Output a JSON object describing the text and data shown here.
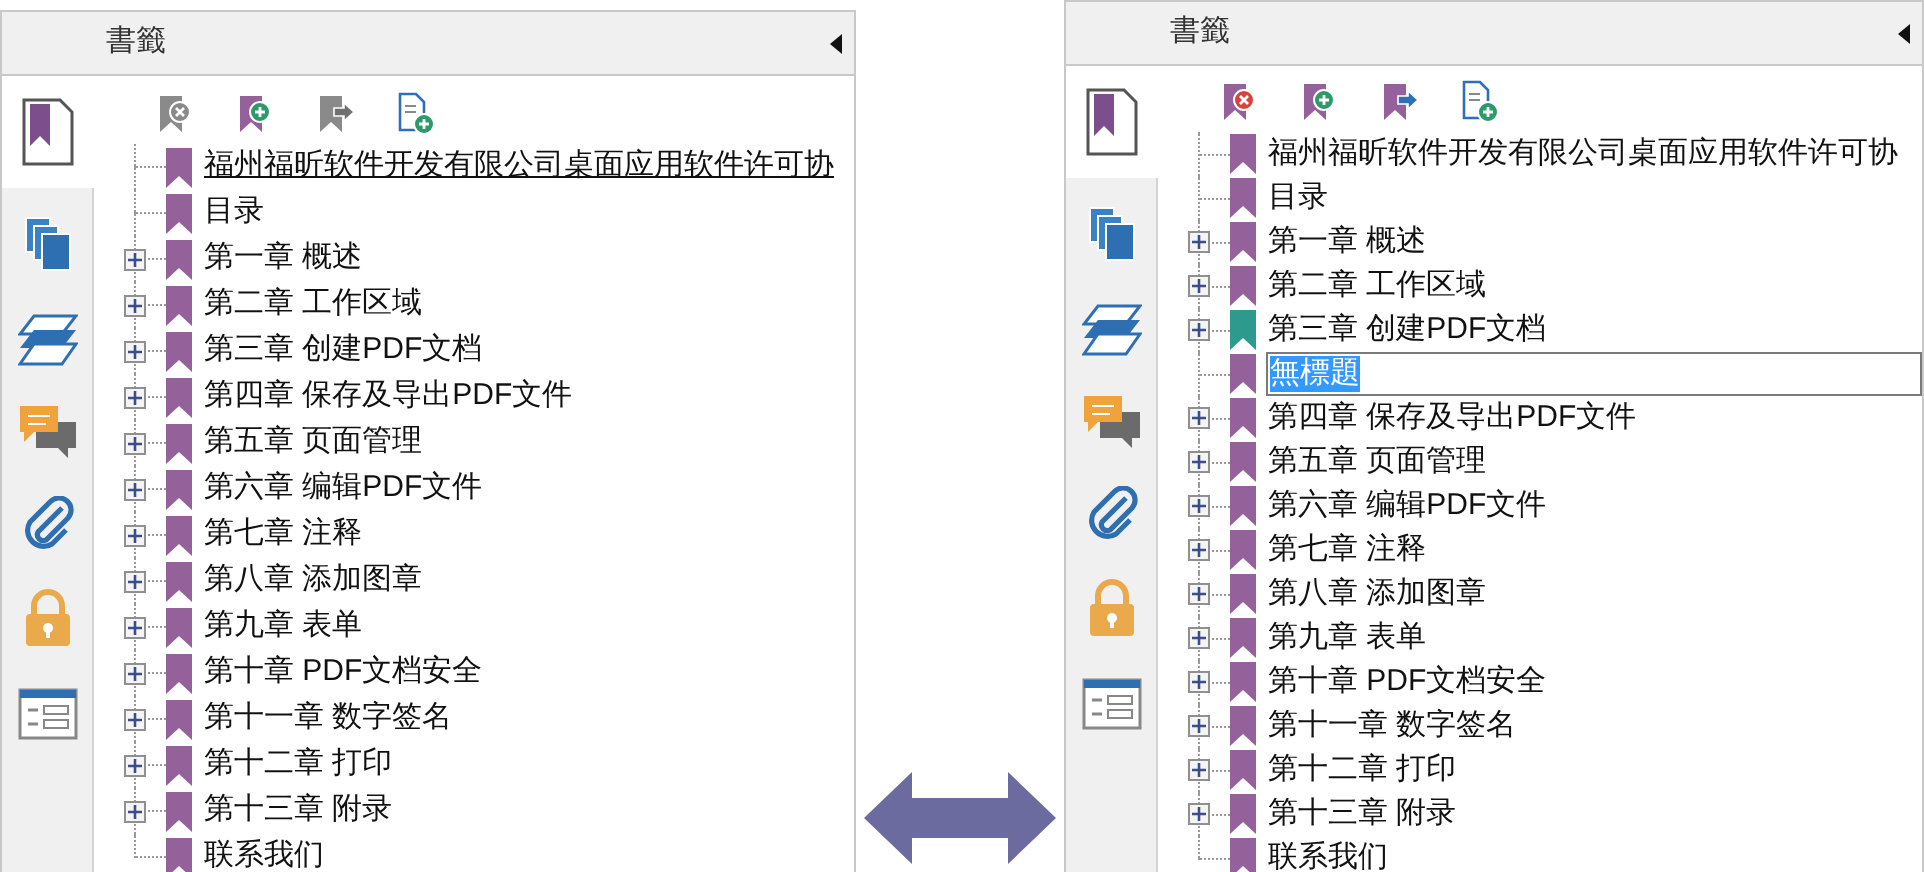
{
  "panels": [
    {
      "title": "書籤",
      "toolbar": [
        {
          "kind": "delete",
          "disabled": true
        },
        {
          "kind": "add",
          "disabled": false
        },
        {
          "kind": "move",
          "disabled": true
        },
        {
          "kind": "new-from-page",
          "disabled": false
        }
      ],
      "items": [
        {
          "text": "福州福昕软件开发有限公司桌面应用软件许可协",
          "expandable": false,
          "underlined": true,
          "editing": false,
          "color": "#94619a"
        },
        {
          "text": "目录",
          "expandable": false,
          "underlined": false,
          "editing": false,
          "color": "#94619a"
        },
        {
          "text": "第一章  概述",
          "expandable": true,
          "underlined": false,
          "editing": false,
          "color": "#94619a"
        },
        {
          "text": "第二章 工作区域",
          "expandable": true,
          "underlined": false,
          "editing": false,
          "color": "#94619a"
        },
        {
          "text": "第三章 创建PDF文档",
          "expandable": true,
          "underlined": false,
          "editing": false,
          "color": "#94619a"
        },
        {
          "text": "第四章 保存及导出PDF文件",
          "expandable": true,
          "underlined": false,
          "editing": false,
          "color": "#94619a"
        },
        {
          "text": "第五章 页面管理",
          "expandable": true,
          "underlined": false,
          "editing": false,
          "color": "#94619a"
        },
        {
          "text": "第六章 编辑PDF文件",
          "expandable": true,
          "underlined": false,
          "editing": false,
          "color": "#94619a"
        },
        {
          "text": "第七章 注释",
          "expandable": true,
          "underlined": false,
          "editing": false,
          "color": "#94619a"
        },
        {
          "text": "第八章 添加图章",
          "expandable": true,
          "underlined": false,
          "editing": false,
          "color": "#94619a"
        },
        {
          "text": "第九章 表单",
          "expandable": true,
          "underlined": false,
          "editing": false,
          "color": "#94619a"
        },
        {
          "text": "第十章 PDF文档安全",
          "expandable": true,
          "underlined": false,
          "editing": false,
          "color": "#94619a"
        },
        {
          "text": "第十一章 数字签名",
          "expandable": true,
          "underlined": false,
          "editing": false,
          "color": "#94619a"
        },
        {
          "text": "第十二章 打印",
          "expandable": true,
          "underlined": false,
          "editing": false,
          "color": "#94619a"
        },
        {
          "text": "第十三章 附录",
          "expandable": true,
          "underlined": false,
          "editing": false,
          "color": "#94619a"
        },
        {
          "text": "联系我们",
          "expandable": false,
          "underlined": false,
          "editing": false,
          "color": "#94619a"
        }
      ]
    },
    {
      "title": "書籤",
      "toolbar": [
        {
          "kind": "delete",
          "disabled": false
        },
        {
          "kind": "add",
          "disabled": false
        },
        {
          "kind": "move",
          "disabled": false
        },
        {
          "kind": "new-from-page",
          "disabled": false
        }
      ],
      "items": [
        {
          "text": "福州福昕软件开发有限公司桌面应用软件许可协",
          "expandable": false,
          "underlined": false,
          "editing": false,
          "color": "#94619a"
        },
        {
          "text": "目录",
          "expandable": false,
          "underlined": false,
          "editing": false,
          "color": "#94619a"
        },
        {
          "text": "第一章  概述",
          "expandable": true,
          "underlined": false,
          "editing": false,
          "color": "#94619a"
        },
        {
          "text": "第二章 工作区域",
          "expandable": true,
          "underlined": false,
          "editing": false,
          "color": "#94619a"
        },
        {
          "text": "第三章 创建PDF文档",
          "expandable": true,
          "underlined": false,
          "editing": false,
          "color": "#2e9a8e"
        },
        {
          "text": "無標題",
          "expandable": false,
          "underlined": false,
          "editing": true,
          "color": "#94619a"
        },
        {
          "text": "第四章 保存及导出PDF文件",
          "expandable": true,
          "underlined": false,
          "editing": false,
          "color": "#94619a"
        },
        {
          "text": "第五章 页面管理",
          "expandable": true,
          "underlined": false,
          "editing": false,
          "color": "#94619a"
        },
        {
          "text": "第六章 编辑PDF文件",
          "expandable": true,
          "underlined": false,
          "editing": false,
          "color": "#94619a"
        },
        {
          "text": "第七章 注释",
          "expandable": true,
          "underlined": false,
          "editing": false,
          "color": "#94619a"
        },
        {
          "text": "第八章 添加图章",
          "expandable": true,
          "underlined": false,
          "editing": false,
          "color": "#94619a"
        },
        {
          "text": "第九章 表单",
          "expandable": true,
          "underlined": false,
          "editing": false,
          "color": "#94619a"
        },
        {
          "text": "第十章 PDF文档安全",
          "expandable": true,
          "underlined": false,
          "editing": false,
          "color": "#94619a"
        },
        {
          "text": "第十一章 数字签名",
          "expandable": true,
          "underlined": false,
          "editing": false,
          "color": "#94619a"
        },
        {
          "text": "第十二章 打印",
          "expandable": true,
          "underlined": false,
          "editing": false,
          "color": "#94619a"
        },
        {
          "text": "第十三章 附录",
          "expandable": true,
          "underlined": false,
          "editing": false,
          "color": "#94619a"
        },
        {
          "text": "联系我们",
          "expandable": false,
          "underlined": false,
          "editing": false,
          "color": "#94619a"
        }
      ]
    }
  ]
}
